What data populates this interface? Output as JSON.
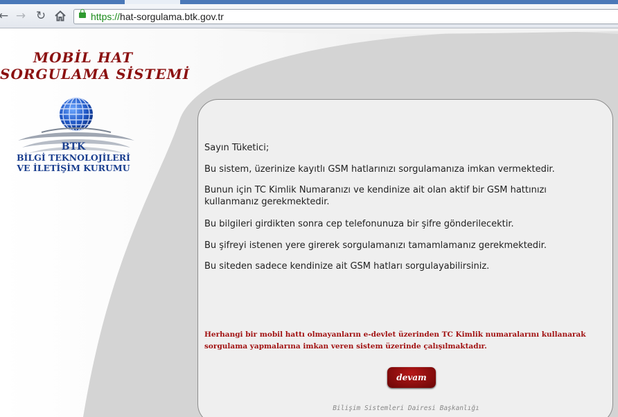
{
  "browser": {
    "url_scheme": "https://",
    "url_host": "hat-sorgulama.btk.gov.tr",
    "back_icon": "back-arrow-icon",
    "forward_icon": "forward-arrow-icon",
    "reload_icon": "reload-icon",
    "home_icon": "home-icon",
    "lock_icon": "lock-icon"
  },
  "header": {
    "title_line1": "MOBİL HAT",
    "title_line2": "SORGULAMA SİSTEMİ"
  },
  "logo": {
    "abbr": "BTK",
    "line1": "BİLGİ TEKNOLOJİLERİ",
    "line2": "VE İLETİŞİM KURUMU"
  },
  "content": {
    "greeting": "Sayın Tüketici;",
    "paragraph1": "Bu sistem, üzerinize kayıtlı GSM hatlarınızı sorgulamanıza imkan vermektedir.",
    "paragraph2": "Bunun için TC Kimlik Numaranızı ve kendinize ait olan aktif bir GSM hattınızı kullanmanız gerekmektedir.",
    "paragraph3": "Bu bilgileri girdikten sonra cep telefonunuza bir şifre gönderilecektir.",
    "paragraph4": "Bu şifreyi istenen yere girerek sorgulamanızı tamamlamanız gerekmektedir.",
    "paragraph5": "Bu siteden sadece kendinize ait GSM hatları sorgulayabilirsiniz.",
    "warning": "Herhangi bir mobil hattı olmayanların e-devlet üzerinden TC Kimlik numaralarını kullanarak sorgulama yapmalarına imkan veren sistem üzerinde çalışılmaktadır.",
    "button_label": "devam",
    "footer": "Bilişim Sistemleri Dairesi Başkanlığı"
  },
  "colors": {
    "brand_red": "#8b1010",
    "logo_blue": "#1b3f8f",
    "warning_red": "#a11212",
    "secure_green": "#1a8a1a"
  }
}
